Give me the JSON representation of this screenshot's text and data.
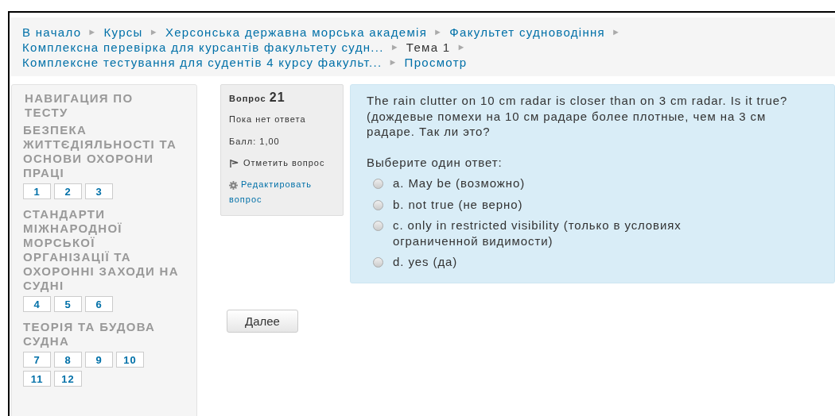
{
  "breadcrumb": [
    [
      {
        "label": "В начало",
        "link": true,
        "separator": "►"
      },
      {
        "label": "Курсы",
        "link": true,
        "separator": "►"
      },
      {
        "label": "Херсонська державна морська академія",
        "link": true,
        "separator": "►"
      },
      {
        "label": "Факультет судноводіння",
        "link": true,
        "separator": "►"
      }
    ],
    [
      {
        "label": "Комплексна перевірка для курсантів факультету судн...",
        "link": true,
        "separator": "►"
      },
      {
        "label": "Тема 1",
        "link": false,
        "separator": "►"
      }
    ],
    [
      {
        "label": "Комплексне тестування для судентів 4 курсу факульт...",
        "link": true,
        "separator": "►"
      },
      {
        "label": "Просмотр",
        "link": true
      }
    ]
  ],
  "navigation": {
    "title": "НАВИГАЦИЯ ПО ТЕСТУ",
    "sections": [
      {
        "title": "БЕЗПЕКА ЖИТТЄДІЯЛЬНОСТІ ТА ОСНОВИ ОХОРОНИ ПРАЦІ",
        "questions": [
          "1",
          "2",
          "3"
        ]
      },
      {
        "title": "СТАНДАРТИ МІЖНАРОДНОЇ МОРСЬКОЇ ОРГАНІЗАЦІЇ ТА ОХОРОННІ ЗАХОДИ НА СУДНІ",
        "questions": [
          "4",
          "5",
          "6"
        ]
      },
      {
        "title": "ТЕОРІЯ ТА БУДОВА СУДНА",
        "questions": [
          "7",
          "8",
          "9",
          "10",
          "11",
          "12"
        ]
      }
    ]
  },
  "question_info": {
    "label": "Вопрос",
    "number": "21",
    "status": "Пока нет ответа",
    "grade": "Балл: 1,00",
    "flag": "Отметить вопрос",
    "edit": "Редактировать вопрос"
  },
  "question": {
    "text": "The rain clutter on 10 cm radar is closer than on 3 cm radar. Is it true? (дождевые помехи на 10 см радаре более плотные, чем на 3 см радаре. Так ли это?",
    "prompt": "Выберите один ответ:",
    "options": [
      {
        "label": "a. May be (возможно)",
        "selected": false
      },
      {
        "label": "b. not true (не верно)",
        "selected": false
      },
      {
        "label": "c. only in restricted visibility (только в условиях ограниченной видимости)",
        "selected": false
      },
      {
        "label": "d. yes (да)",
        "selected": false
      }
    ]
  },
  "next_button": "Далее"
}
